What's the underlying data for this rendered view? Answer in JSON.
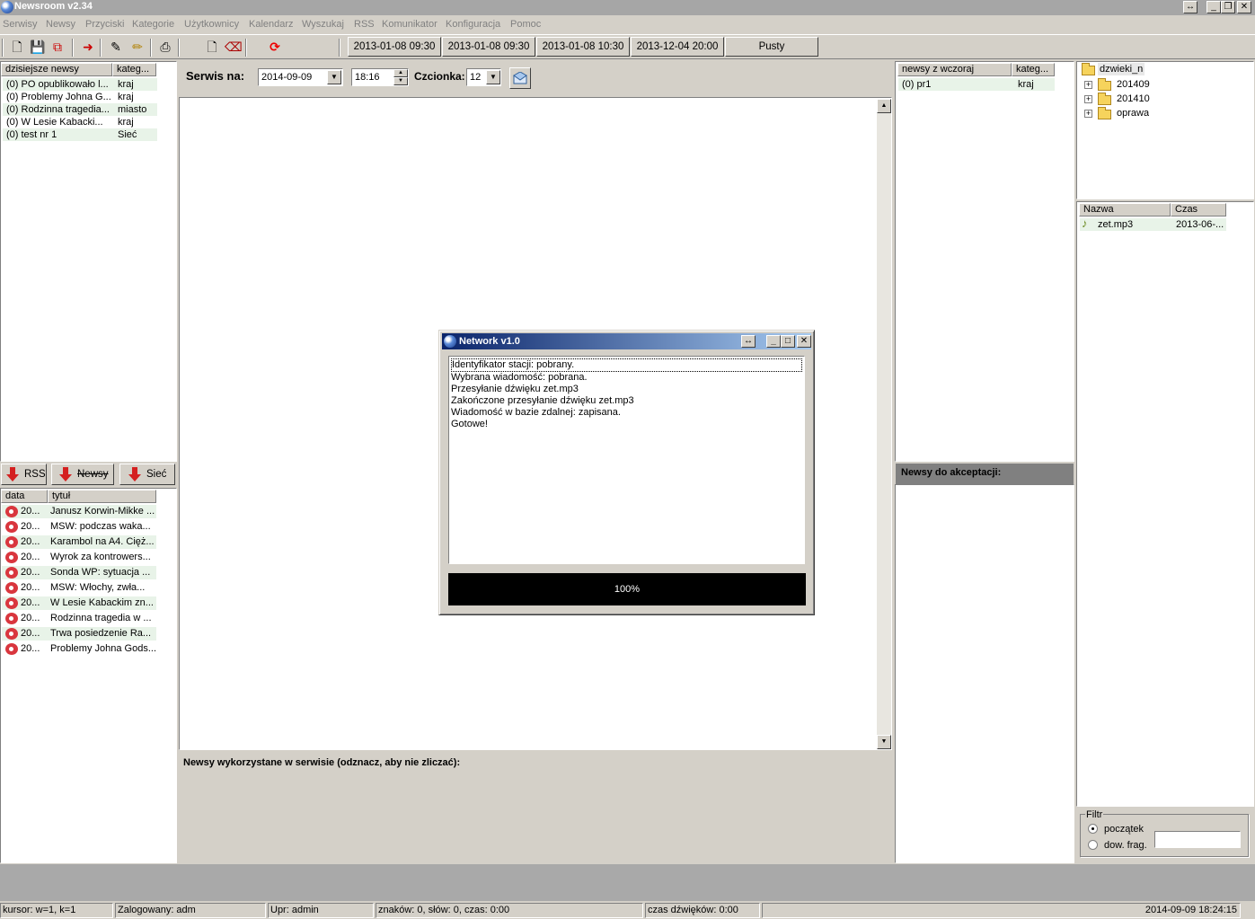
{
  "window": {
    "title": "Newsroom v2.34",
    "controls": [
      "↔",
      "_",
      "❐",
      "✕"
    ]
  },
  "menu": [
    "Serwisy",
    "Newsy",
    "Przyciski",
    "Kategorie",
    "Użytkownicy",
    "Kalendarz",
    "Wyszukaj",
    "RSS",
    "Komunikator",
    "Konfiguracja",
    "Pomoc"
  ],
  "toolbar": {
    "icons": [
      "new-document-icon",
      "save-icon",
      "copy-icon",
      "export-icon",
      "edit-icon",
      "pencil-icon",
      "print-icon",
      "blank-page-icon",
      "eraser-icon",
      "refresh-icon"
    ],
    "schedule_buttons": [
      "2013-01-08 09:30",
      "2013-01-08 09:30",
      "2013-01-08 10:30",
      "2013-12-04 20:00",
      "Pusty"
    ]
  },
  "today_news": {
    "columns": [
      "dzisiejsze newsy",
      "kateg..."
    ],
    "rows": [
      {
        "title": "(0) PO opublikowało l...",
        "cat": "kraj"
      },
      {
        "title": "(0) Problemy Johna G...",
        "cat": "kraj"
      },
      {
        "title": "(0) Rodzinna tragedia...",
        "cat": "miasto"
      },
      {
        "title": "(0) W Lesie Kabacki...",
        "cat": "kraj"
      },
      {
        "title": "(0) test nr 1",
        "cat": "Sieć"
      }
    ]
  },
  "feed_buttons": {
    "rss": "RSS",
    "newsy": "Newsy",
    "siec": "Sieć"
  },
  "feed_list": {
    "columns": [
      "data",
      "tytuł"
    ],
    "rows": [
      {
        "date": "20...",
        "title": "Janusz Korwin-Mikke ..."
      },
      {
        "date": "20...",
        "title": "MSW: podczas waka..."
      },
      {
        "date": "20...",
        "title": "Karambol na A4. Cięż..."
      },
      {
        "date": "20...",
        "title": "Wyrok za kontrowers..."
      },
      {
        "date": "20...",
        "title": "Sonda WP: sytuacja ..."
      },
      {
        "date": "20...",
        "title": "MSW: Włochy, zwła..."
      },
      {
        "date": "20...",
        "title": "W Lesie Kabackim zn..."
      },
      {
        "date": "20...",
        "title": "Rodzinna tragedia w ..."
      },
      {
        "date": "20...",
        "title": "Trwa posiedzenie Ra..."
      },
      {
        "date": "20...",
        "title": "Problemy Johna Gods..."
      }
    ]
  },
  "service": {
    "label": "Serwis na:",
    "date": "2014-09-09",
    "time": "18:16",
    "font_label": "Czcionka:",
    "font_size": "12",
    "used_label": "Newsy wykorzystane w serwisie (odznacz, aby nie zliczać):"
  },
  "yesterday_news": {
    "columns": [
      "newsy z wczoraj",
      "kateg..."
    ],
    "rows": [
      {
        "title": "(0) pr1",
        "cat": "kraj"
      }
    ]
  },
  "accept_label": "Newsy do akceptacji:",
  "folders": {
    "root": "dzwieki_n",
    "children": [
      "201409",
      "201410",
      "oprawa"
    ]
  },
  "files": {
    "columns": [
      "Nazwa",
      "Czas"
    ],
    "rows": [
      {
        "name": "zet.mp3",
        "time": "2013-06-..."
      }
    ]
  },
  "filter": {
    "title": "Filtr",
    "options": [
      "początek",
      "dow. frag."
    ],
    "selected": "początek",
    "value": ""
  },
  "dialog": {
    "title": "Network v1.0",
    "log": [
      "Identyfikator stacji: pobrany.",
      "Wybrana wiadomość: pobrana.",
      "Przesyłanie dźwięku zet.mp3",
      "Zakończone przesyłanie dźwięku zet.mp3",
      "Wiadomość w bazie zdalnej: zapisana.",
      "Gotowe!"
    ],
    "progress_label": "100%",
    "progress": 1.0
  },
  "status": {
    "cursor": "kursor: w=1, k=1",
    "user": "Zalogowany: adm",
    "rights": "Upr: admin",
    "counts": "znaków: 0, słów: 0, czas: 0:00",
    "sound_time": "czas dźwięków: 0:00",
    "datetime": "2014-09-09 18:24:15"
  }
}
